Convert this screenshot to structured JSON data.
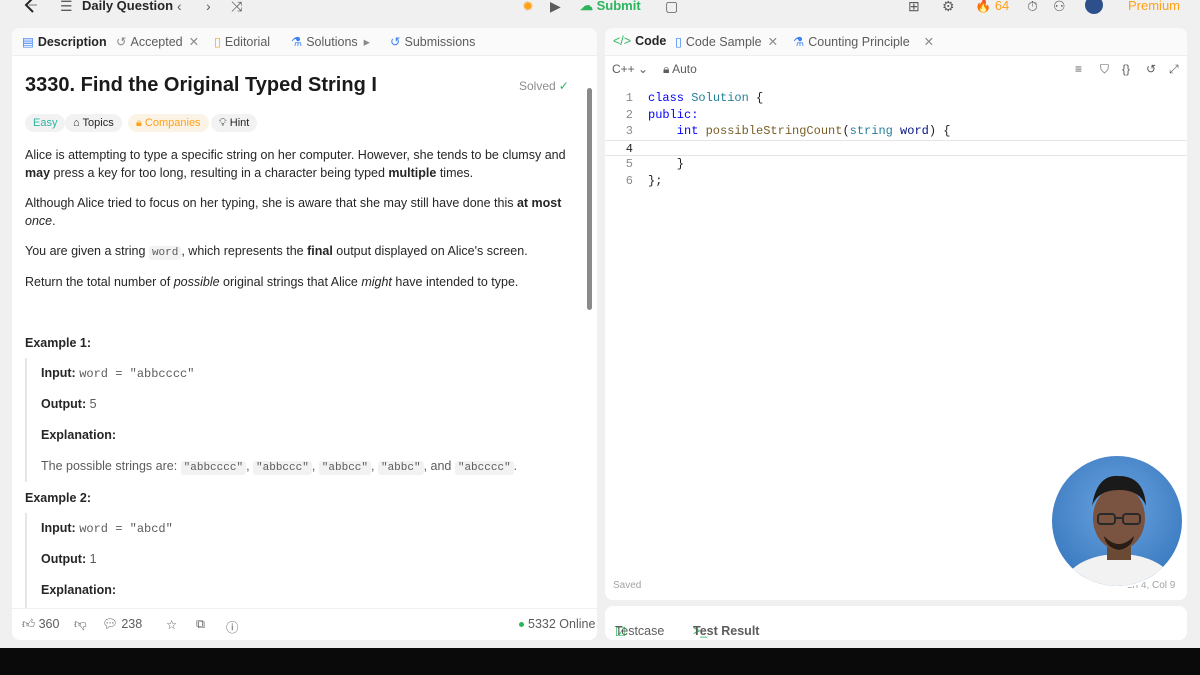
{
  "topbar": {
    "title": "Daily Question",
    "submit_label": "Submit",
    "streak_count": "64",
    "premium_label": "Premium"
  },
  "left_tabs": [
    {
      "label": "Description",
      "icon": "description-icon"
    },
    {
      "label": "Accepted",
      "icon": "history-icon"
    },
    {
      "label": "Editorial",
      "icon": "book-icon"
    },
    {
      "label": "Solutions",
      "icon": "flask-icon"
    },
    {
      "label": "Submissions",
      "icon": "history-icon"
    }
  ],
  "problem": {
    "title": "3330. Find the Original Typed String I",
    "status": "Solved",
    "difficulty": "Easy",
    "topics_label": "Topics",
    "companies_label": "Companies",
    "hint_label": "Hint",
    "p1a": "Alice is attempting to type a specific string on her computer. However, she tends to be clumsy and ",
    "p1b": "may",
    "p1c": " press a key for too long, resulting in a character being typed ",
    "p1d": "multiple",
    "p1e": " times.",
    "p2a": "Although Alice tried to focus on her typing, she is aware that she may still have done this ",
    "p2b": "at most",
    "p2c": "once",
    "p2d": ".",
    "p3a": "You are given a string ",
    "p3b": "word",
    "p3c": ", which represents the ",
    "p3d": "final",
    "p3e": " output displayed on Alice's screen.",
    "p4a": "Return the total number of ",
    "p4b": "possible",
    "p4c": " original strings that Alice ",
    "p4d": "might",
    "p4e": " have intended to type."
  },
  "examples": [
    {
      "title": "Example 1:",
      "input_label": "Input:",
      "input": "word = \"abbcccc\"",
      "output_label": "Output:",
      "output": "5",
      "explanation_label": "Explanation:",
      "explanation_text": "The possible strings are: ",
      "strings": [
        "\"abbcccc\"",
        "\"abbccc\"",
        "\"abbcc\"",
        "\"abbc\"",
        "\"abcccc\""
      ],
      "sep1": ", ",
      "sep_and": ", and ",
      "end": "."
    },
    {
      "title": "Example 2:",
      "input_label": "Input:",
      "input": "word = \"abcd\"",
      "output_label": "Output:",
      "output": "1",
      "explanation_label": "Explanation:"
    }
  ],
  "footer": {
    "likes": "360",
    "comments": "238",
    "online": "5332 Online"
  },
  "code_tabs": [
    {
      "label": "Code",
      "icon": "code-icon"
    },
    {
      "label": "Code Sample",
      "icon": "document-icon"
    },
    {
      "label": "Counting Principle",
      "icon": "flask-icon"
    }
  ],
  "editor": {
    "language": "C++",
    "mode": "Auto",
    "saved_label": "Saved",
    "cursor_pos": "Ln 4, Col 9",
    "line_numbers": [
      "1",
      "2",
      "3",
      "4",
      "5",
      "6"
    ],
    "l1a": "class ",
    "l1b": "Solution",
    "l1c": " {",
    "l2": "public:",
    "l3a": "    int ",
    "l3b": "possibleStringCount",
    "l3c": "(",
    "l3d": "string",
    "l3e": " word",
    "l3f": ") {",
    "l4": "        ",
    "l5": "    }",
    "l6": "};"
  },
  "bottom_tabs": {
    "testcase": "Testcase",
    "test_result": "Test Result"
  },
  "colors": {
    "accent": "#ffa116",
    "easy": "#2db5a3",
    "submit": "#2db55d"
  }
}
